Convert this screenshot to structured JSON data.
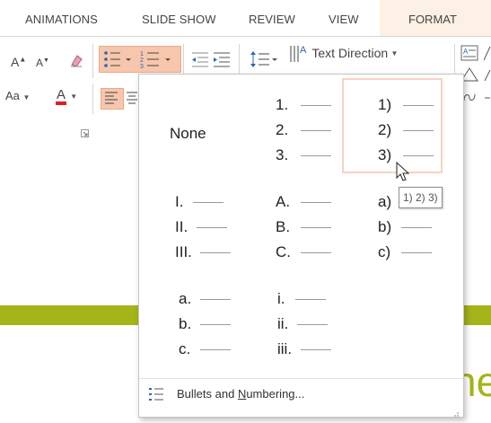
{
  "tabs": [
    "ANIMATIONS",
    "SLIDE SHOW",
    "REVIEW",
    "VIEW",
    "FORMAT"
  ],
  "ribbon": {
    "grow_font": "A",
    "shrink_font": "A",
    "change_case": "Aa",
    "font_color": "A",
    "text_direction": "Text Direction",
    "align_text_partial": "A",
    "colors": {
      "highlight": "#f6c7ac",
      "font_color_bar": "#e31c23",
      "accent_green": "#a5b418"
    }
  },
  "gallery": {
    "none_label": "None",
    "numbered": [
      "1.",
      "2.",
      "3."
    ],
    "paren": [
      "1)",
      "2)",
      "3)"
    ],
    "roman": [
      "I.",
      "II.",
      "III."
    ],
    "upper_alpha": [
      "A.",
      "B.",
      "C."
    ],
    "lower_alpha_paren": [
      "a)",
      "b)",
      "c)"
    ],
    "lower_alpha": [
      "a.",
      "b.",
      "c."
    ],
    "lower_roman": [
      "i.",
      "ii.",
      "iii."
    ],
    "tooltip": "1) 2) 3)",
    "footer": {
      "label_before": "Bullets and ",
      "label_underlined": "N",
      "label_after": "umbering..."
    }
  },
  "slide": {
    "visible_text": "ne"
  }
}
